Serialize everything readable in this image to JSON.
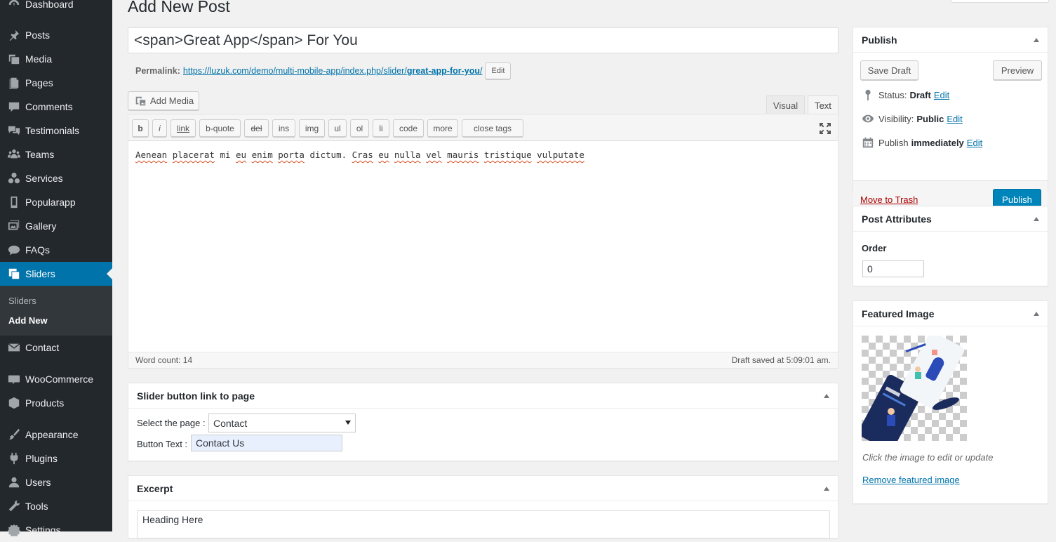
{
  "sidebar": {
    "items": [
      {
        "label": "Dashboard",
        "icon": "dashboard-icon"
      },
      {
        "label": "Posts",
        "icon": "pin-icon"
      },
      {
        "label": "Media",
        "icon": "media-icon"
      },
      {
        "label": "Pages",
        "icon": "pages-icon"
      },
      {
        "label": "Comments",
        "icon": "comment-icon"
      },
      {
        "label": "Testimonials",
        "icon": "testimonial-icon"
      },
      {
        "label": "Teams",
        "icon": "groups-icon"
      },
      {
        "label": "Services",
        "icon": "services-icon"
      },
      {
        "label": "Popularapp",
        "icon": "phone-icon"
      },
      {
        "label": "Gallery",
        "icon": "gallery-icon"
      },
      {
        "label": "FAQs",
        "icon": "faq-icon"
      },
      {
        "label": "Sliders",
        "icon": "slides-icon"
      },
      {
        "label": "Contact",
        "icon": "email-icon"
      },
      {
        "label": "WooCommerce",
        "icon": "woo-icon"
      },
      {
        "label": "Products",
        "icon": "archive-icon"
      },
      {
        "label": "Appearance",
        "icon": "brush-icon"
      },
      {
        "label": "Plugins",
        "icon": "plugin-icon"
      },
      {
        "label": "Users",
        "icon": "user-icon"
      },
      {
        "label": "Tools",
        "icon": "wrench-icon"
      },
      {
        "label": "Settings",
        "icon": "settings-icon"
      }
    ],
    "submenu": [
      "Sliders",
      "Add New"
    ]
  },
  "page": {
    "title": "Add New Post",
    "post_title": "<span>Great App</span> For You",
    "permalink_label": "Permalink:",
    "permalink_base": "https://luzuk.com/demo/multi-mobile-app/index.php/slider/",
    "permalink_slug": "great-app-for-you",
    "permalink_end": "/",
    "edit_label": "Edit"
  },
  "editor": {
    "add_media": "Add Media",
    "tab_visual": "Visual",
    "tab_text": "Text",
    "quicktags": [
      "b",
      "i",
      "link",
      "b-quote",
      "del",
      "ins",
      "img",
      "ul",
      "ol",
      "li",
      "code",
      "more",
      "close tags"
    ],
    "content_words": [
      "Aenean",
      "placerat",
      "mi",
      "eu",
      "enim",
      "porta",
      "dictum.",
      "Cras",
      "eu",
      "nulla",
      "vel",
      "mauris",
      "tristique",
      "vulputate"
    ],
    "word_count": "Word count: 14",
    "draft_saved": "Draft saved at 5:09:01 am."
  },
  "slider_box": {
    "title": "Slider button link to page",
    "select_label": "Select the page :",
    "select_value": "Contact",
    "button_text_label": "Button Text :",
    "button_text_value": "Contact Us"
  },
  "excerpt": {
    "title": "Excerpt",
    "value": "Heading Here"
  },
  "publish": {
    "title": "Publish",
    "save_draft": "Save Draft",
    "preview": "Preview",
    "status_label": "Status:",
    "status_value": "Draft",
    "visibility_label": "Visibility:",
    "visibility_value": "Public",
    "schedule_label": "Publish",
    "schedule_value": "immediately",
    "edit": "Edit",
    "trash": "Move to Trash",
    "publish_btn": "Publish"
  },
  "attributes": {
    "title": "Post Attributes",
    "order_label": "Order",
    "order_value": "0"
  },
  "featured": {
    "title": "Featured Image",
    "hint": "Click the image to edit or update",
    "remove": "Remove featured image"
  },
  "colors": {
    "sidebar_bg": "#23282d",
    "accent": "#0073aa",
    "primary_button": "#0085ba",
    "trash": "#a00"
  }
}
